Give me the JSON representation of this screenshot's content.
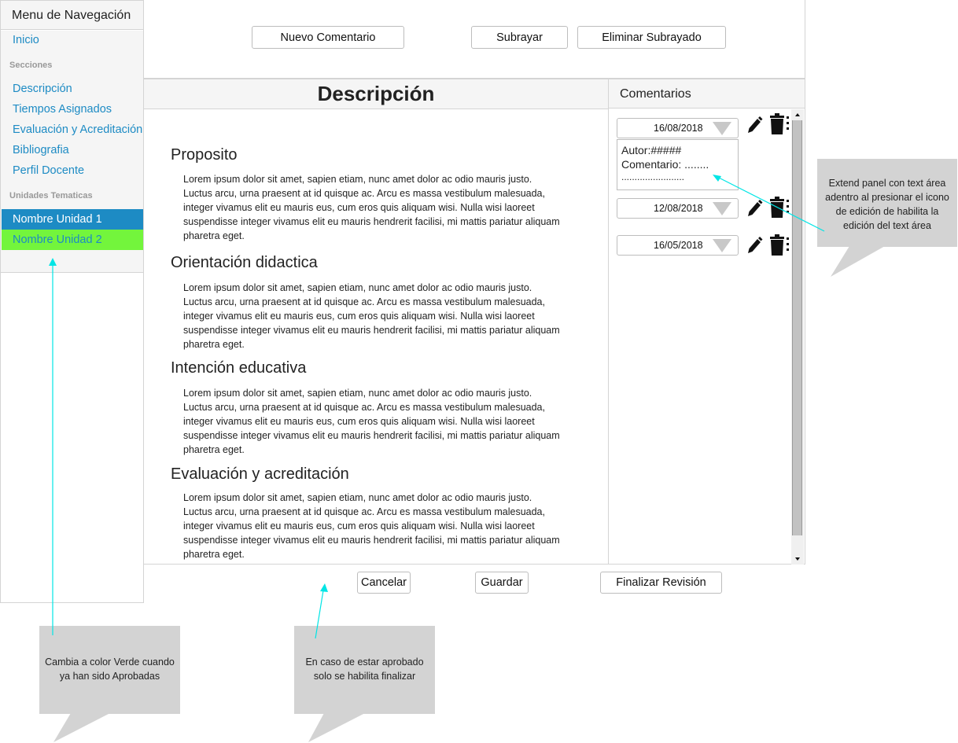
{
  "sidebar": {
    "title": "Menu de Navegación",
    "home": "Inicio",
    "sections_label": "Secciones",
    "sections": [
      "Descripción",
      "Tiempos Asignados",
      "Evaluación y Acreditación",
      "Bibliografia",
      "Perfil Docente"
    ],
    "units_label": "Unidades Tematicas",
    "units": [
      {
        "label": "Nombre Unidad 1",
        "color": "#1d8bc4"
      },
      {
        "label": "Nombre Unidad 2",
        "color": "#73f53c"
      }
    ]
  },
  "toolbar": {
    "new_comment": "Nuevo Comentario",
    "underline": "Subrayar",
    "remove_underline": "Eliminar Subrayado"
  },
  "description": {
    "title": "Descripción",
    "sections": [
      {
        "title": "Proposito",
        "body": "Lorem ipsum dolor sit amet, sapien etiam, nunc amet dolor ac odio mauris justo. Luctus arcu, urna praesent at id quisque ac. Arcu es massa vestibulum malesuada, integer vivamus elit eu mauris eus, cum eros quis aliquam wisi. Nulla wisi laoreet suspendisse integer vivamus elit eu mauris hendrerit facilisi, mi mattis pariatur aliquam pharetra eget."
      },
      {
        "title": "Orientación didactica",
        "body": "Lorem ipsum dolor sit amet, sapien etiam, nunc amet dolor ac odio mauris justo. Luctus arcu, urna praesent at id quisque ac. Arcu es massa vestibulum malesuada, integer vivamus elit eu mauris eus, cum eros quis aliquam wisi. Nulla wisi laoreet suspendisse integer vivamus elit eu mauris hendrerit facilisi, mi mattis pariatur aliquam pharetra eget."
      },
      {
        "title": "Intención educativa",
        "body": "Lorem ipsum dolor sit amet, sapien etiam, nunc amet dolor ac odio mauris justo. Luctus arcu, urna praesent at id quisque ac. Arcu es massa vestibulum malesuada, integer vivamus elit eu mauris eus, cum eros quis aliquam wisi. Nulla wisi laoreet suspendisse integer vivamus elit eu mauris hendrerit facilisi, mi mattis pariatur aliquam pharetra eget."
      },
      {
        "title": "Evaluación y acreditación",
        "body": "Lorem ipsum dolor sit amet, sapien etiam, nunc amet dolor ac odio mauris justo. Luctus arcu, urna praesent at id quisque ac. Arcu es massa vestibulum malesuada, integer vivamus elit eu mauris eus, cum eros quis aliquam wisi. Nulla wisi laoreet suspendisse integer vivamus elit eu mauris hendrerit facilisi, mi mattis pariatur aliquam pharetra eget."
      }
    ]
  },
  "comments": {
    "title": "Comentarios",
    "items": [
      {
        "date": "16/08/2018",
        "author_line": "Autor:#####",
        "comment_line": "Comentario: ........",
        "dots_line": "........................"
      },
      {
        "date": "12/08/2018"
      },
      {
        "date": "16/05/2018"
      }
    ],
    "icons": [
      "pencil-icon",
      "trash-icon"
    ]
  },
  "footer": {
    "cancel": "Cancelar",
    "save": "Guardar",
    "finish": "Finalizar Revisión"
  },
  "annotations": {
    "extend_panel": [
      "Extend panel con text área",
      "adentro al presionar el icono",
      "de edición de habilita la",
      "edición del text área"
    ],
    "green_units": [
      "Cambia a color Verde cuando",
      "ya han sido Aprobadas"
    ],
    "approved": [
      "En caso de estar aprobado",
      "solo se habilita finalizar"
    ],
    "arrow_color": "#00e5e5"
  }
}
